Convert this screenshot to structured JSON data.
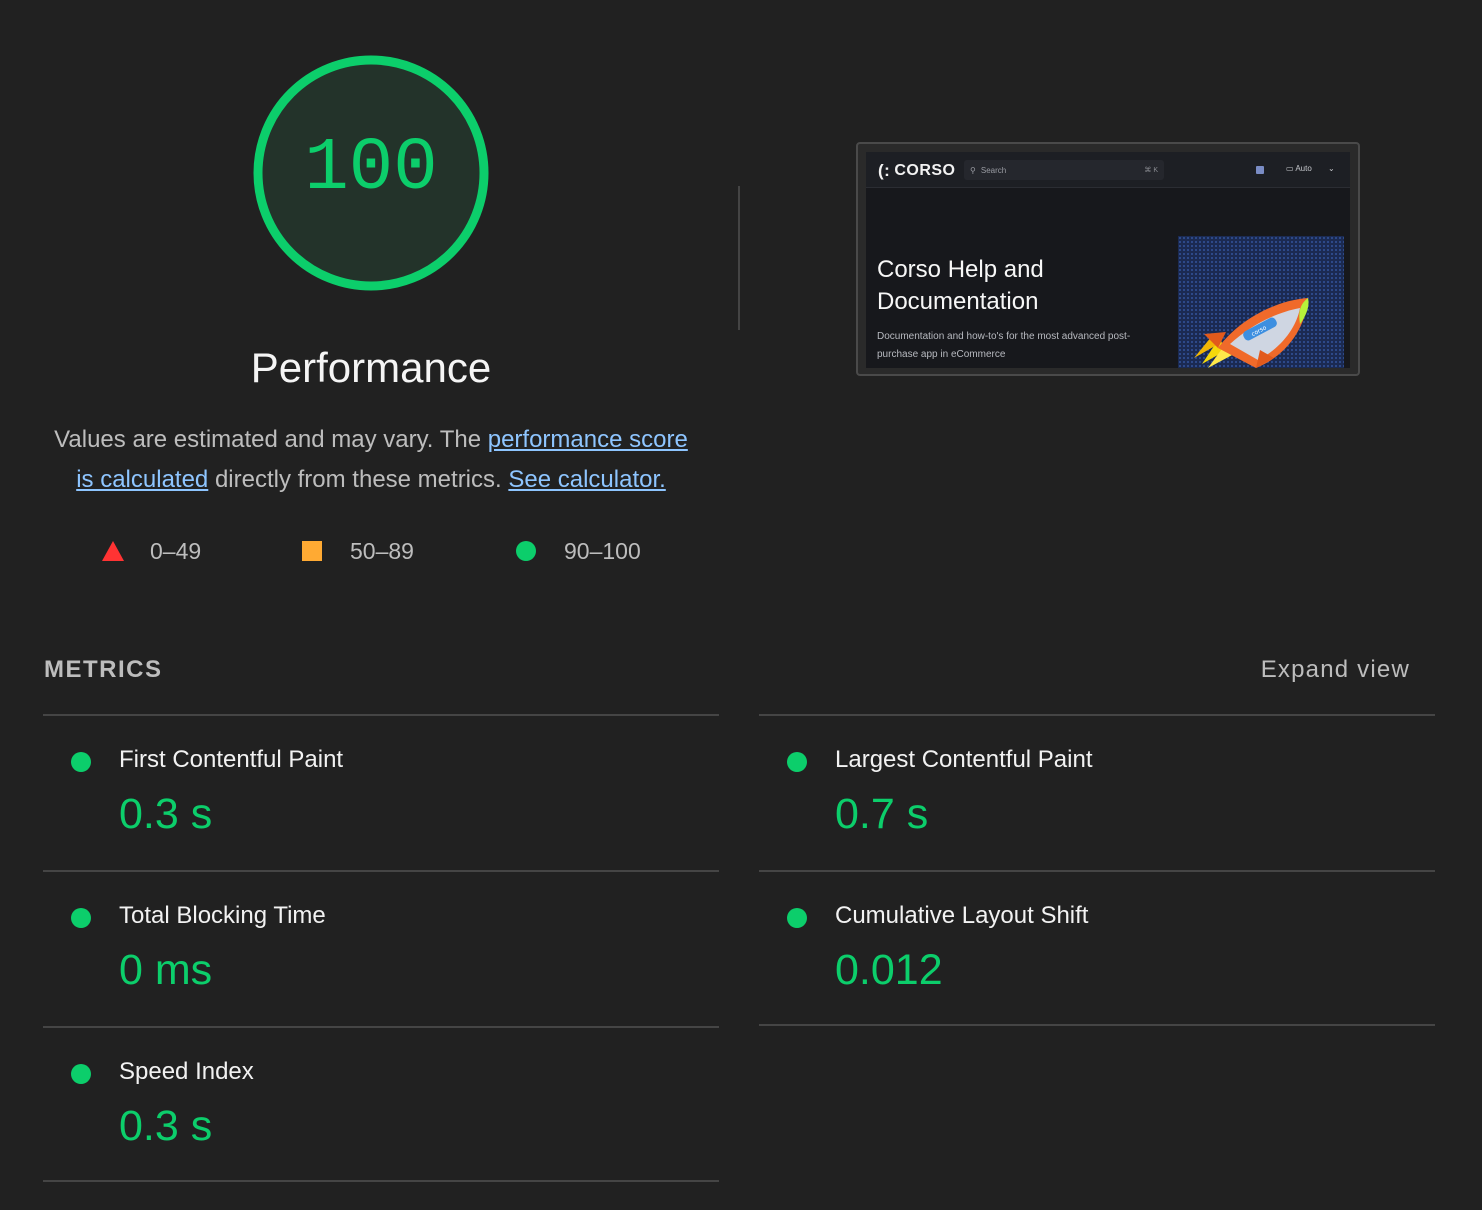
{
  "score": {
    "value": "100",
    "fraction": 1.0,
    "title": "Performance",
    "color": "#0cce6b"
  },
  "description": {
    "text_before": "Values are estimated and may vary. The ",
    "link_score": "performance score is calculated",
    "text_middle": " directly from these metrics. ",
    "link_calculator": "See calculator."
  },
  "legend": [
    {
      "shape": "triangle",
      "range": "0–49",
      "color": "#ff3333"
    },
    {
      "shape": "square",
      "range": "50–89",
      "color": "#ffaa33"
    },
    {
      "shape": "circle",
      "range": "90–100",
      "color": "#0cce6b"
    }
  ],
  "screenshot": {
    "logo_mark": "(:",
    "logo": "CORSO",
    "search_placeholder": "Search",
    "search_shortcut": "⌘ K",
    "theme_label": "Auto",
    "heading": "Corso Help and Documentation",
    "subheading": "Documentation and how-to's for the most advanced post-purchase app in eCommerce",
    "rocket_label": "corso"
  },
  "metrics": {
    "title": "METRICS",
    "expand_label": "Expand view",
    "items": [
      {
        "name": "First Contentful Paint",
        "value": "0.3 s"
      },
      {
        "name": "Largest Contentful Paint",
        "value": "0.7 s"
      },
      {
        "name": "Total Blocking Time",
        "value": "0 ms"
      },
      {
        "name": "Cumulative Layout Shift",
        "value": "0.012"
      },
      {
        "name": "Speed Index",
        "value": "0.3 s"
      }
    ]
  }
}
